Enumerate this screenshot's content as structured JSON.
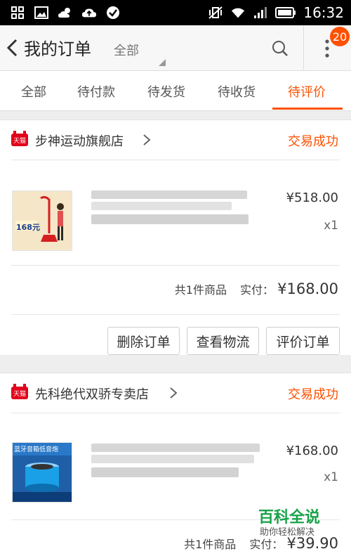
{
  "status_bar": {
    "time": "16:32"
  },
  "header": {
    "title": "我的订单",
    "filter": "全部",
    "badge": "20"
  },
  "tabs": [
    {
      "label": "全部"
    },
    {
      "label": "待付款"
    },
    {
      "label": "待发货"
    },
    {
      "label": "待收货"
    },
    {
      "label": "待评价"
    }
  ],
  "active_tab": "待评价",
  "orders": [
    {
      "shop_tag": "天猫",
      "shop": "步神运动旗舰店",
      "status": "交易成功",
      "thumb_text": "168元",
      "price": "¥518.00",
      "qty": "x1",
      "count_label": "共1件商品",
      "paid_label": "实付：",
      "paid": "¥168.00",
      "buttons": [
        "删除订单",
        "查看物流",
        "评价订单"
      ]
    },
    {
      "shop_tag": "天猫",
      "shop": "先科绝代双骄专卖店",
      "status": "交易成功",
      "thumb_text": "蓝牙音箱低音炮",
      "price": "¥168.00",
      "qty": "x1",
      "count_label": "共1件商品",
      "paid_label": "实付：",
      "paid": "¥39.90"
    }
  ],
  "watermark": {
    "main": "百科全说",
    "sub": "助你轻松解决"
  }
}
